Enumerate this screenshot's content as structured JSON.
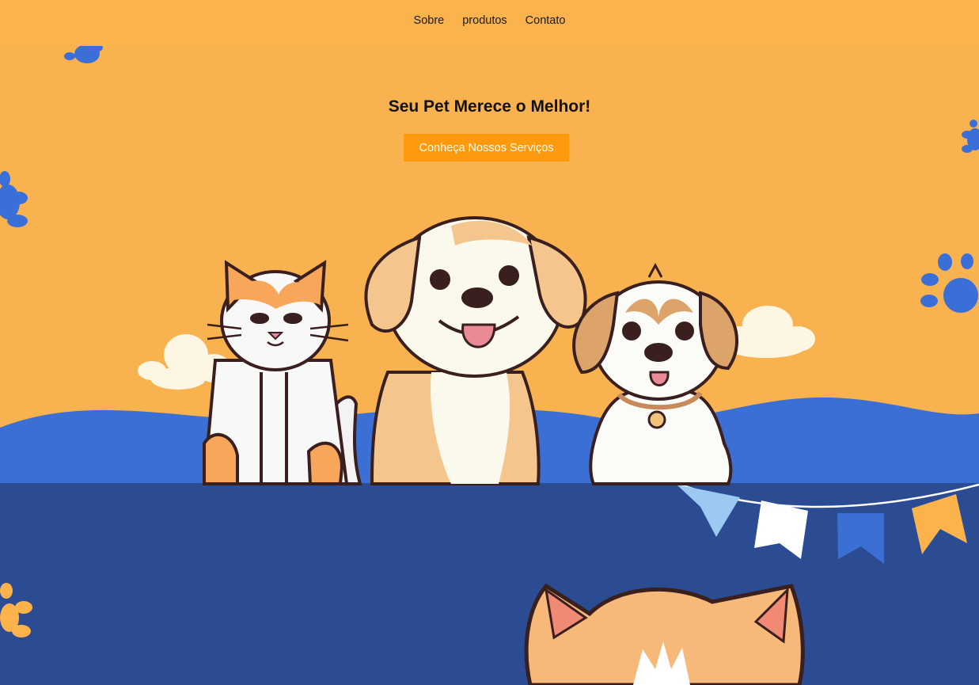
{
  "nav": {
    "items": [
      {
        "label": "Sobre"
      },
      {
        "label": "produtos"
      },
      {
        "label": "Contato"
      }
    ]
  },
  "hero": {
    "title": "Seu Pet Merece o Melhor!",
    "cta_label": "Conheça Nossos Serviços"
  },
  "colors": {
    "nav_background": "#fbb34d",
    "hero_background": "#f8b24f",
    "wave_blue": "#3b6fd4",
    "lower_background": "#2b4b93",
    "cta_background": "#fe9a0b",
    "paw_blue": "#3a6fd8",
    "paw_orange": "#fcb34c"
  },
  "illustration": {
    "animals": [
      "cat-illustration",
      "puppy-illustration",
      "small-dog-illustration",
      "cat-head-peeking"
    ],
    "decorations": [
      "paw-print-icon",
      "cloud",
      "bunting-flags"
    ]
  }
}
